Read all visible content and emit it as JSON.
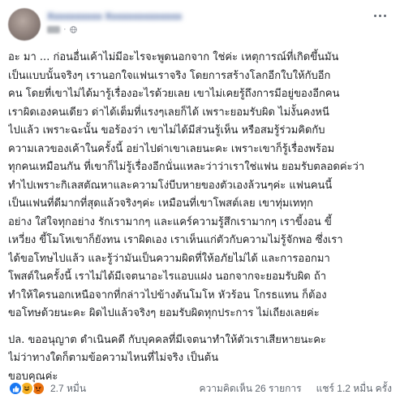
{
  "post": {
    "author": "Xxxxxxxxxx Xxxxxxxxxxxxxx",
    "meta_separator": "·",
    "paragraphs": [
      [
        "อะ มา ... ก่อนอื่นเค้าไม่มีอะไรจะพูดนอกจาก ใช่ค่ะ เหตุการณ์ที่เกิดขึ้นมัน",
        "เป็นแบบนั้นจริงๆ เรานอกใจแฟนเราจริง โดยการสร้างโลกอีกใบให้กับอีก",
        "คน โดยที่เขาไม่ได้มารู้เรื่องอะไรด้วยเลย เขาไม่เคยรู้ถึงการมีอยู่ของอีกคน",
        "เราผิดเองคนเดียว ด่าได้เต็มที่แรงๆเลยก็ได้ เพราะยอมรับผิด ไม่งั้นคงหนี",
        "ไปแล้ว เพราะฉะนั้น ขอร้องว่า เขาไม่ได้มีส่วนรู้เห็น หรือสมรู้ร่วมคิดกับ",
        "ความเลวของเค้าในครั้งนี้ อย่าไปด่าเขาเลยนะคะ เพราะเขาก็รู้เรื่องพร้อม",
        "ทุกคนเหมือนกัน ที่เขาก็ไม่รู้เรื่องอีกนั่นแหละว่าว่าเราใช่แฟน ยอมรับตลอดค่ะว่า",
        "ทำไปเพราะกิเลสตัณหาและความโง่บีบหายของตัวเองล้วนๆค่ะ แฟนคนนี้",
        "เป็นแฟนที่ดีมากที่สุดแล้วจริงๆค่ะ เหมือนที่เขาโพสต์เลย เขาทุ่มเททุก",
        "อย่าง ใส่ใจทุกอย่าง รักเรามากๆ และแคร์ความรู้สึกเรามากๆ เราขี้งอน ขี้",
        "เหวี่ยง ขี้โมโหเขาก็ยังทน เราผิดเอง เราเห็นแก่ตัวกับความไม่รู้จักพอ ซึ่งเรา",
        "ได้ขอโทษไปแล้ว และรู้ว่ามันเป็นความผิดที่ให้อภัยไม่ได้ และการออกมา",
        "โพสต์ในครั้งนี้ เราไม่ได้มีเจตนาอะไรแอบแฝง นอกจากจะยอมรับผิด ถ้า",
        "ทำให้ใครนอกเหนือจากที่กล่าวไปข้างต้นโมโห หัวร้อน โกรธแทน ก็ต้อง",
        "ขอโทษด้วยนะคะ ผิดไปแล้วจริงๆ ยอมรับผิดทุกประการ ไม่เถียงเลยค่ะ"
      ],
      [
        "ปล. ขออนุญาต ดำเนินคดี กับบุคคลที่มีเจตนาทำให้ตัวเราเสียหายนะคะ",
        "ไม่ว่าทางใดก็ตามข้อความไหนที่ไม่จริง เป็นต้น",
        "ขอบคุณค่ะ"
      ]
    ]
  },
  "footer": {
    "reaction_count": "2.7 หมื่น",
    "comments": "ความคิดเห็น 26 รายการ",
    "shares": "แชร์ 1.2 หมื่น ครั้ง"
  },
  "icons": {
    "reactions": [
      "like-icon",
      "haha-icon",
      "angry-icon"
    ],
    "privacy": "globe-icon",
    "more": "more-options-icon"
  },
  "colors": {
    "author_link": "#385898",
    "meta_text": "#90949c",
    "like": "#1877f2",
    "haha": "#f7b125",
    "angry": "#e9710f"
  }
}
